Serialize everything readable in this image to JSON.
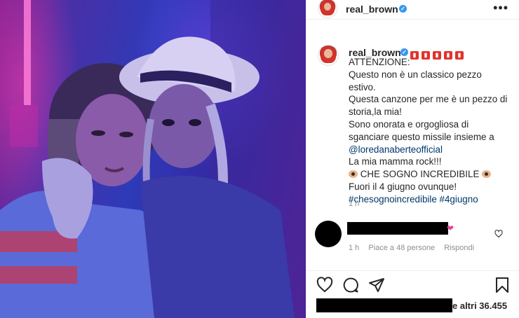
{
  "post": {
    "username": "real_brown",
    "verified_symbol": "✓",
    "header_more_icon": "more-horizontal-icon",
    "caption_emojis": [
      "fire-extinguisher-emoji",
      "fire-extinguisher-emoji",
      "fire-extinguisher-emoji",
      "fire-extinguisher-emoji",
      "fire-extinguisher-emoji"
    ],
    "caption_lines": [
      "ATTENZIONE:",
      "Questo non è un classico pezzo",
      "estivo.",
      "Questa canzone per me è un pezzo di",
      "storia,la mia!",
      "Sono onorata e orgogliosa di",
      "sganciare questo missile insieme a"
    ],
    "mention": "@loredanaberteofficial",
    "line_rock": "La mia mamma rock!!!",
    "line_dream": "CHE SOGNO INCREDIBILE",
    "line_out": "Fuori il 4 giugno ovunque!",
    "hashtags": "#chesognoincredibile #4giugno",
    "time_ago": "1 h"
  },
  "comment": {
    "time_ago": "1 h",
    "likes": "Piace a 48 persone",
    "reply": "Rispondi",
    "heart_emoji": "❤"
  },
  "actions": {
    "like_icon": "heart-icon",
    "comment_icon": "comment-icon",
    "share_icon": "share-icon",
    "save_icon": "bookmark-icon"
  },
  "likes_summary": "e altri 36.455",
  "colors": {
    "link": "#00376b",
    "verified": "#3897f0",
    "muted": "#8e8e8e"
  }
}
